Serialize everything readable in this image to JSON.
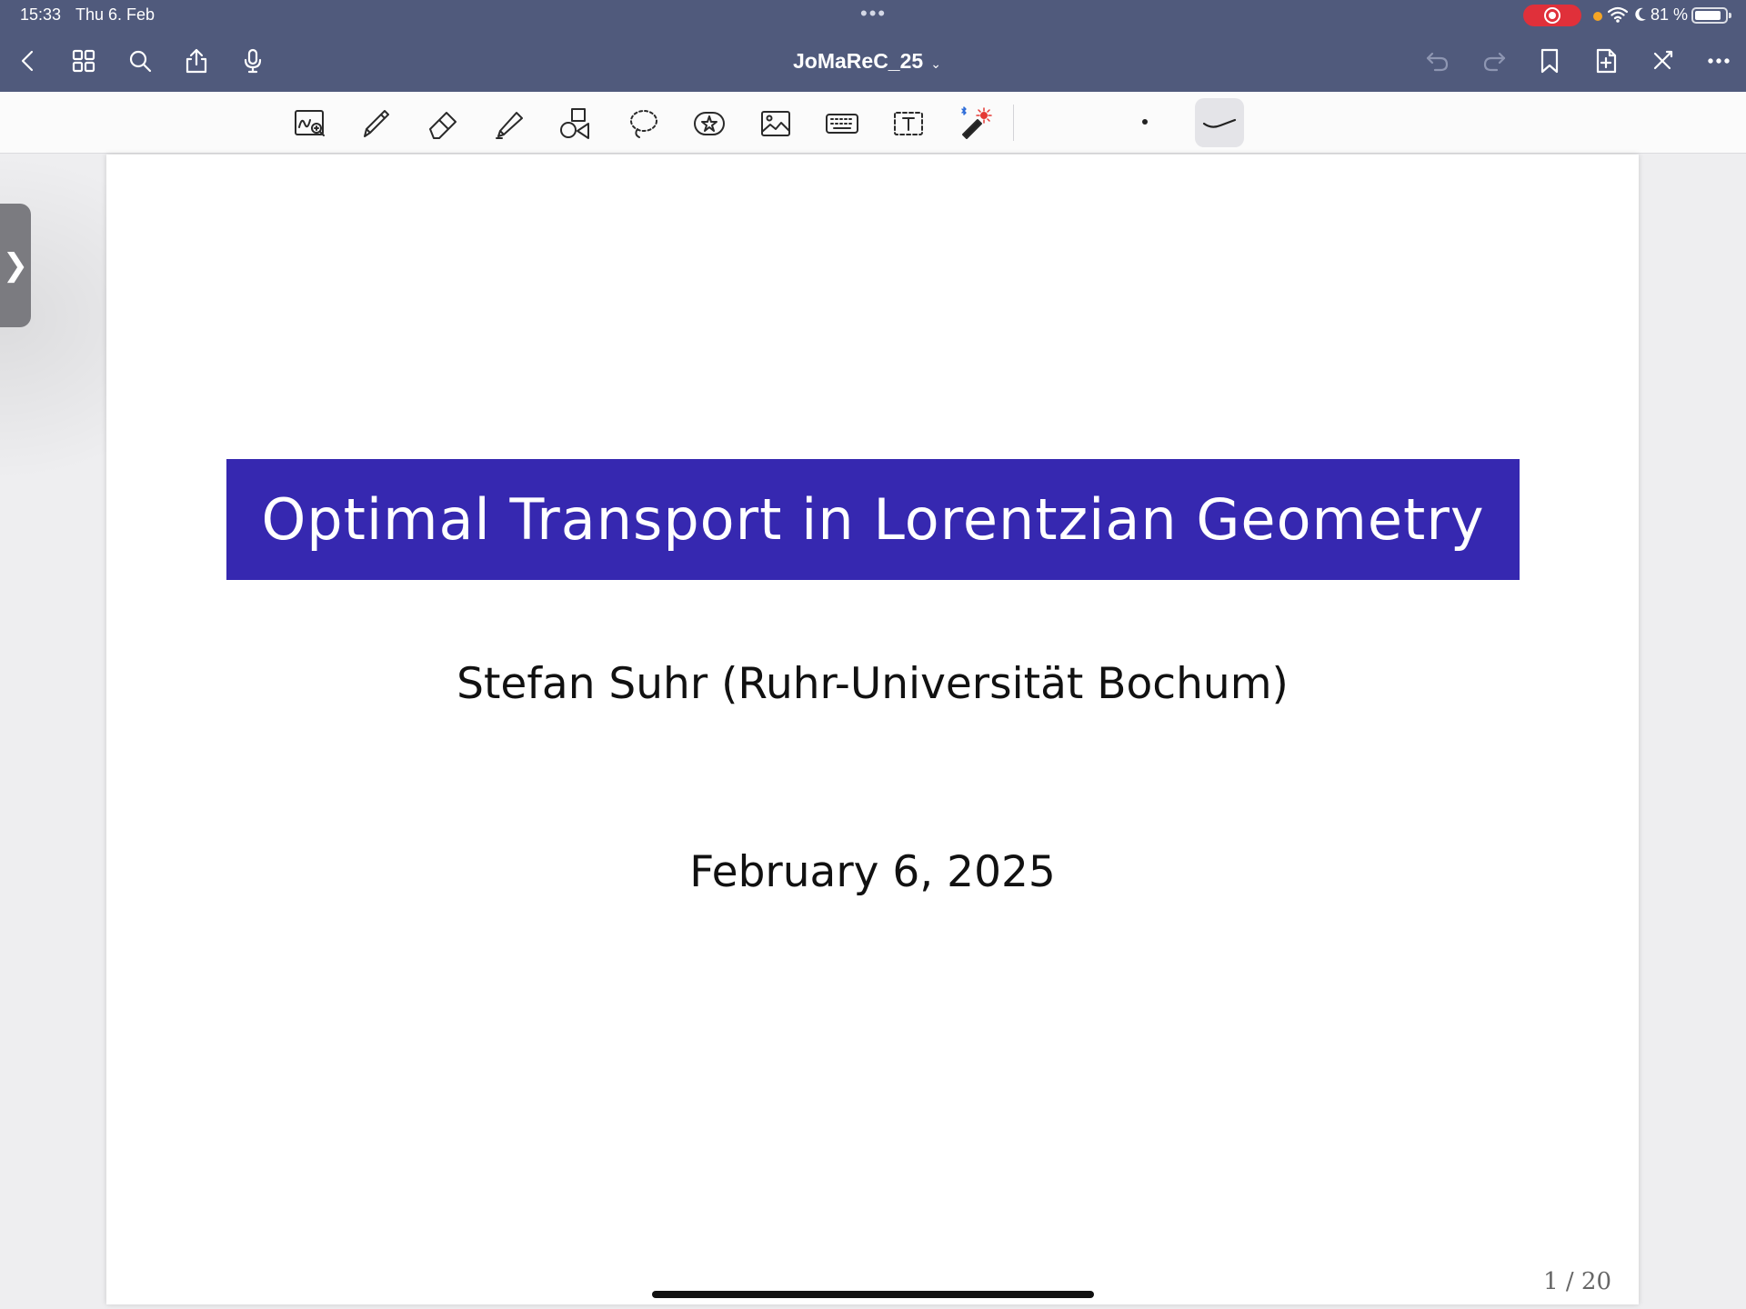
{
  "status": {
    "time": "15:33",
    "date": "Thu 6. Feb",
    "dots": "•••",
    "wifi_moon": "✦ ☾",
    "battery": "81 %"
  },
  "nav": {
    "title": "JoMaReC_25",
    "chevron": "⌄"
  },
  "side_handle": "❯",
  "slide": {
    "title": "Optimal Transport in Lorentzian Geometry",
    "author": "Stefan Suhr (Ruhr-Universität Bochum)",
    "date": "February 6, 2025",
    "page": "1 / 20"
  },
  "colors": {
    "bar": "#505a7c",
    "title_bg": "#3628b0",
    "record": "#e0303a"
  }
}
